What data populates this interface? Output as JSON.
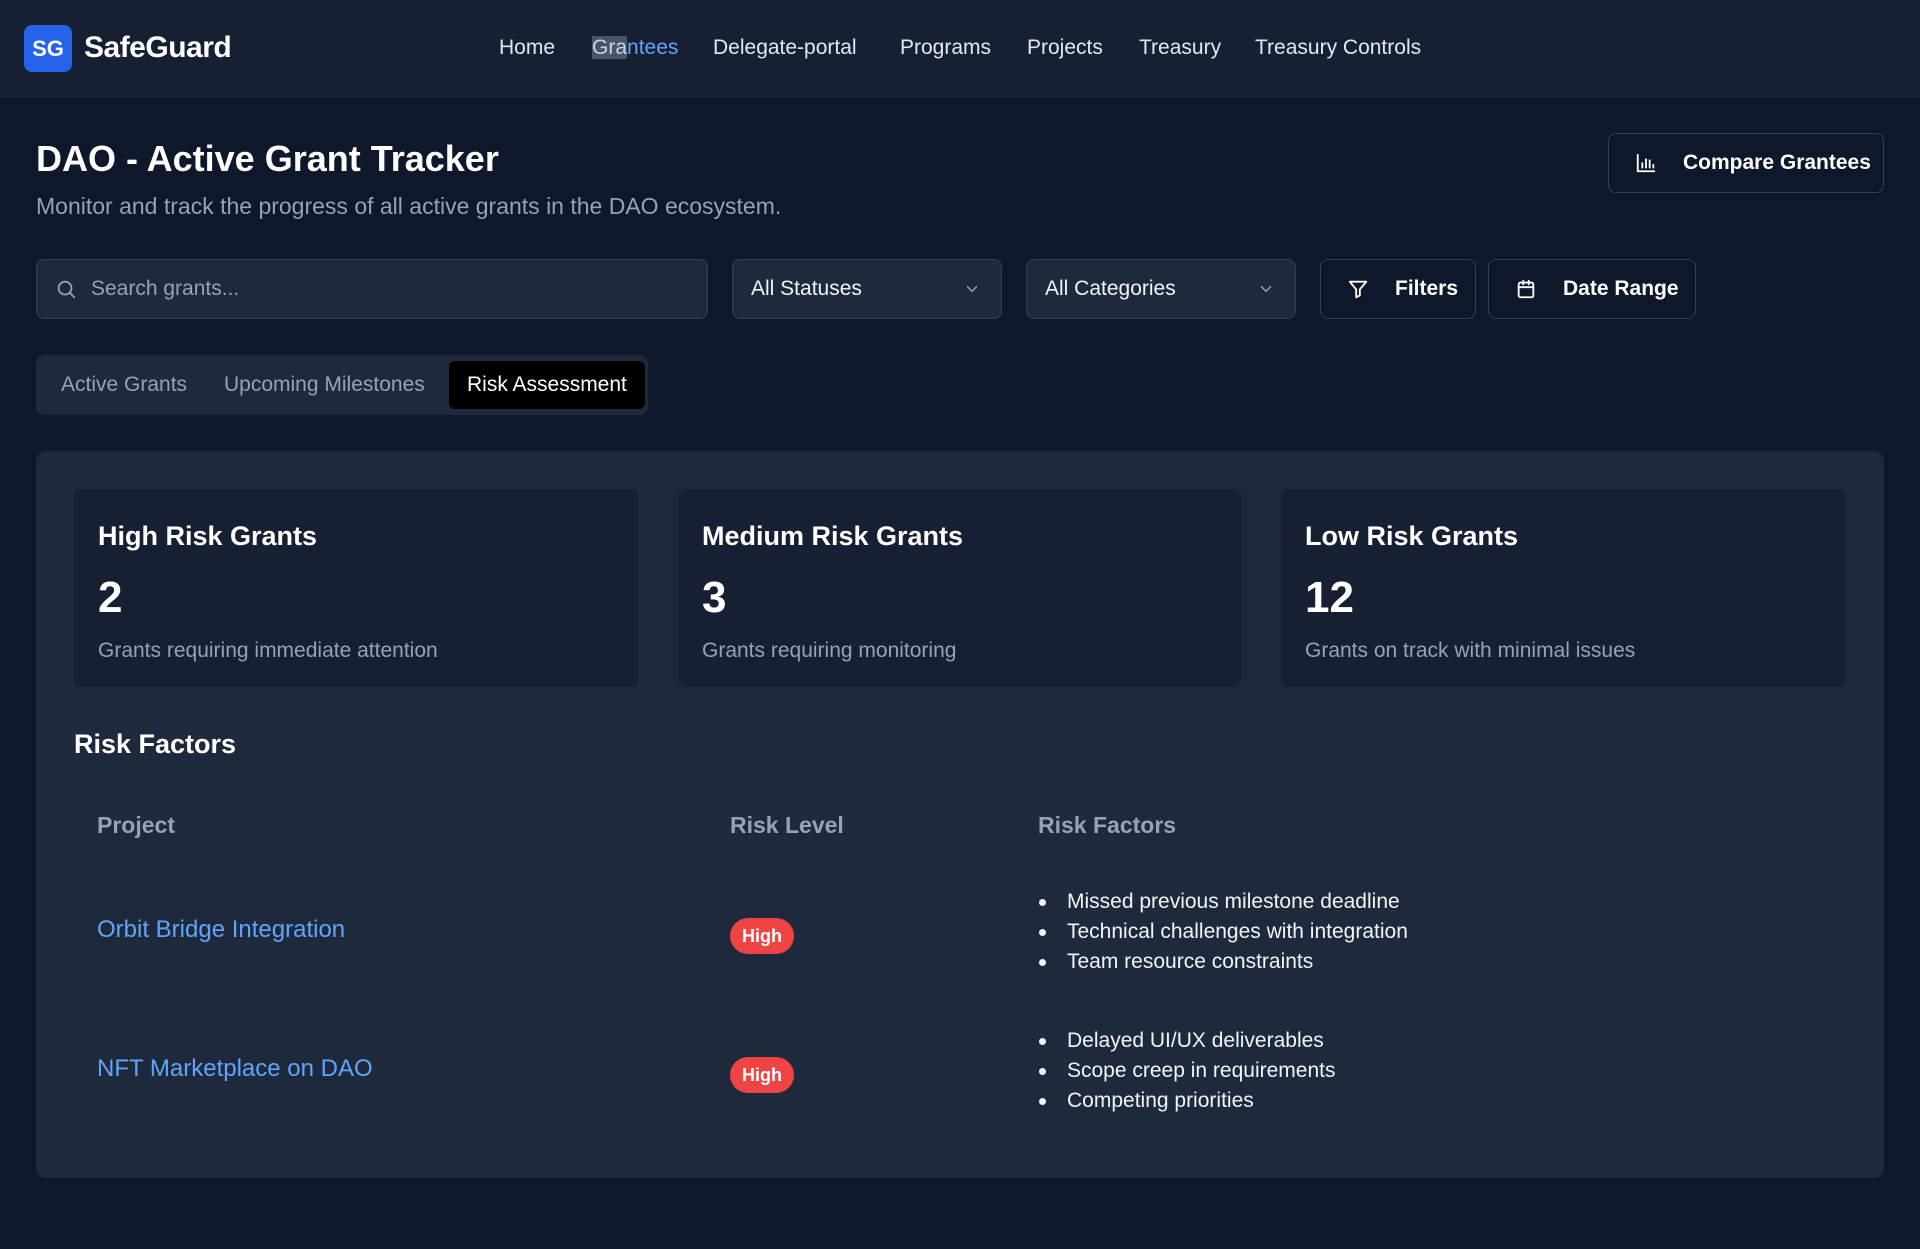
{
  "nav": {
    "logo": "SG",
    "brand": "SafeGuard",
    "links": [
      "Home",
      "Grantees",
      "Delegate-portal",
      "Programs",
      "Projects",
      "Treasury",
      "Treasury Controls"
    ],
    "grantees_selected_part": "Gra",
    "grantees_rest_part": "ntees"
  },
  "header": {
    "title": "DAO - Active Grant Tracker",
    "subtitle": "Monitor and track the progress of all active grants in the DAO ecosystem.",
    "compare_label": "Compare Grantees"
  },
  "filters": {
    "search_placeholder": "Search grants...",
    "status_value": "All Statuses",
    "category_value": "All Categories",
    "filters_label": "Filters",
    "date_range_label": "Date Range"
  },
  "tabs": [
    "Active Grants",
    "Upcoming Milestones",
    "Risk Assessment"
  ],
  "cards": [
    {
      "title": "High Risk Grants",
      "value": "2",
      "desc": "Grants requiring immediate attention"
    },
    {
      "title": "Medium Risk Grants",
      "value": "3",
      "desc": "Grants requiring monitoring"
    },
    {
      "title": "Low Risk Grants",
      "value": "12",
      "desc": "Grants on track with minimal issues"
    }
  ],
  "risk_factors": {
    "title": "Risk Factors",
    "columns": [
      "Project",
      "Risk Level",
      "Risk Factors"
    ],
    "rows": [
      {
        "project": "Orbit Bridge Integration",
        "level": "High",
        "factors": [
          "Missed previous milestone deadline",
          "Technical challenges with integration",
          "Team resource constraints"
        ]
      },
      {
        "project": "NFT Marketplace on DAO",
        "level": "High",
        "factors": [
          "Delayed UI/UX deliverables",
          "Scope creep in requirements",
          "Competing priorities"
        ]
      }
    ]
  },
  "colors": {
    "background": "#0f172a",
    "panel": "#1e293b",
    "accent": "#2563eb",
    "link": "#60a5fa",
    "high_badge": "#ef4444"
  },
  "icons": [
    "bar-chart-icon",
    "search-icon",
    "chevron-down-icon",
    "filter-icon",
    "calendar-icon"
  ]
}
